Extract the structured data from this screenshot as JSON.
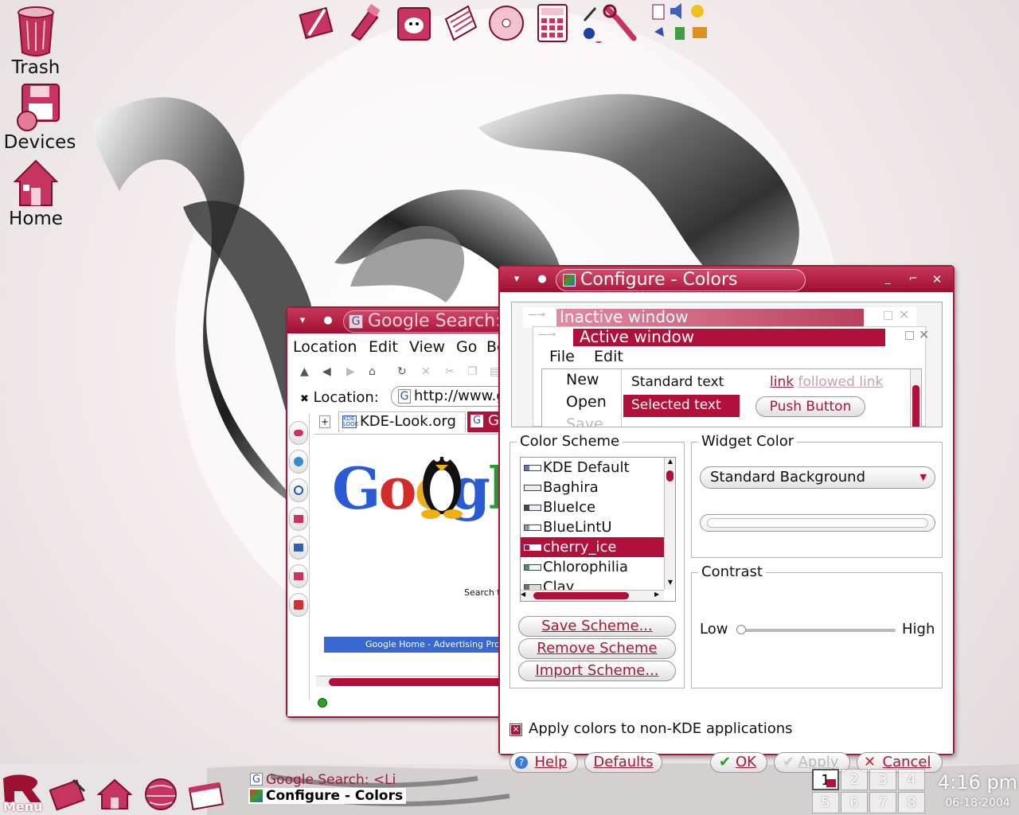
{
  "desktop": {
    "icons": [
      {
        "label": "Trash",
        "icon": "trash-icon"
      },
      {
        "label": "Devices",
        "icon": "floppy-icon"
      },
      {
        "label": "Home",
        "icon": "home-icon"
      }
    ]
  },
  "quick_launch": [
    "graphics-icon",
    "paint-icon",
    "gimp-icon",
    "document-icon",
    "cd-icon",
    "calculator-icon",
    "color-picker-icon",
    "settings-wrench-icon",
    "applets-icon"
  ],
  "browser": {
    "title": "Google Search: <Li",
    "menu": [
      "Location",
      "Edit",
      "View",
      "Go",
      "Bo"
    ],
    "location_label": "Location:",
    "location_value": "http://www.g",
    "tabs": [
      "KDE-Look.org",
      "Go"
    ],
    "search_text": "Search t",
    "footer_links": "Google Home - Advertising Prog",
    "logo_text": "Googl"
  },
  "dialog": {
    "title": "Configure - Colors",
    "preview": {
      "inactive_window": "Inactive window",
      "active_window": "Active window",
      "menu": [
        "File",
        "Edit"
      ],
      "menu_items": [
        "New",
        "Open",
        "Save"
      ],
      "standard_text": "Standard text",
      "selected_text": "Selected text",
      "link": "link",
      "followed_link": "followed link",
      "push_button": "Push Button"
    },
    "color_scheme": {
      "title": "Color Scheme",
      "items": [
        "KDE Default",
        "Baghira",
        "BlueIce",
        "BlueLintU",
        "cherry_ice",
        "Chlorophilia",
        "Clay"
      ],
      "selected": "cherry_ice",
      "save": "Save Scheme...",
      "remove": "Remove Scheme",
      "import": "Import Scheme..."
    },
    "widget_color": {
      "title": "Widget Color",
      "selected": "Standard Background"
    },
    "contrast": {
      "title": "Contrast",
      "low": "Low",
      "high": "High",
      "value": 0.0
    },
    "apply_non_kde": "Apply colors to non-KDE applications",
    "apply_non_kde_checked": true,
    "buttons": {
      "help": "Help",
      "defaults": "Defaults",
      "ok": "OK",
      "apply": "Apply",
      "cancel": "Cancel"
    }
  },
  "taskbar": {
    "menu_label": "Menu",
    "tasks": [
      "Google Search: <Li",
      "Configure - Colors"
    ],
    "pager": [
      "1",
      "2",
      "3",
      "4",
      "5",
      "6",
      "7",
      "8"
    ],
    "active_desktop": "1",
    "time": "4:16 pm",
    "date": "06-18-2004"
  },
  "colors": {
    "accent": "#a01a3a",
    "accent_light": "#c8375a"
  }
}
